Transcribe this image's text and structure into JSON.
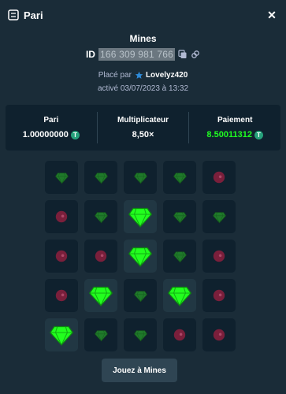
{
  "header": {
    "title": "Pari",
    "close_glyph": "✕"
  },
  "game": {
    "name": "Mines",
    "id_label": "ID",
    "id_value": "166 309 981 766"
  },
  "placed": {
    "prefix": "Placé par",
    "username": "Lovelyz420",
    "activated": "activé 03/07/2023 à 13:32"
  },
  "stats": [
    {
      "label": "Pari",
      "value": "1.00000000",
      "currency_symbol": "T",
      "highlight": false
    },
    {
      "label": "Multiplicateur",
      "value": "8,50×",
      "currency_symbol": "",
      "highlight": false
    },
    {
      "label": "Paiement",
      "value": "8.50011312",
      "currency_symbol": "T",
      "highlight": true
    }
  ],
  "board": {
    "rows": [
      [
        "gem",
        "gem",
        "gem",
        "gem",
        "mine"
      ],
      [
        "mine",
        "gem",
        "gem-found",
        "gem",
        "gem"
      ],
      [
        "mine",
        "mine",
        "gem-found",
        "gem",
        "mine"
      ],
      [
        "mine",
        "gem-found",
        "gem",
        "gem-found",
        "mine"
      ],
      [
        "gem-found",
        "gem",
        "gem",
        "mine",
        "mine"
      ]
    ]
  },
  "colors": {
    "gem_bright": "#22ff1e",
    "gem_dim": "#1f7a2a",
    "mine": "#7a1f3b",
    "payout": "#1fff20",
    "tether": "#26a17b"
  },
  "action_button": {
    "label": "Jouez à Mines"
  }
}
